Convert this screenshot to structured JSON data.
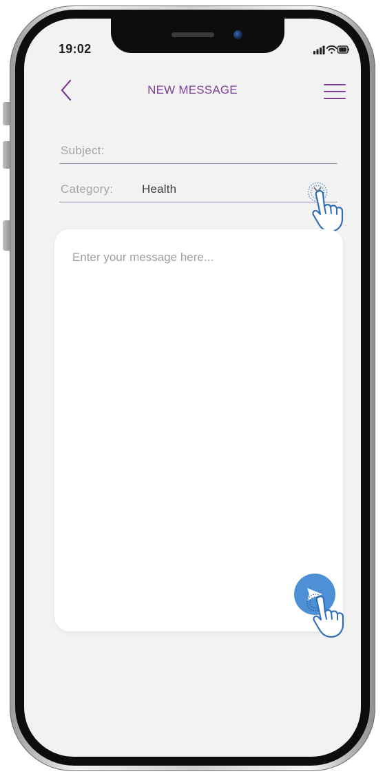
{
  "status": {
    "time": "19:02"
  },
  "header": {
    "title": "NEW MESSAGE"
  },
  "form": {
    "subject_label": "Subject:",
    "subject_value": "",
    "category_label": "Category:",
    "category_value": "Health"
  },
  "message": {
    "placeholder": "Enter your message here...",
    "value": ""
  },
  "colors": {
    "accent": "#7b3f92",
    "send": "#4d90d6",
    "screen_bg": "#f2f2f2",
    "card_bg": "#ffffff"
  }
}
